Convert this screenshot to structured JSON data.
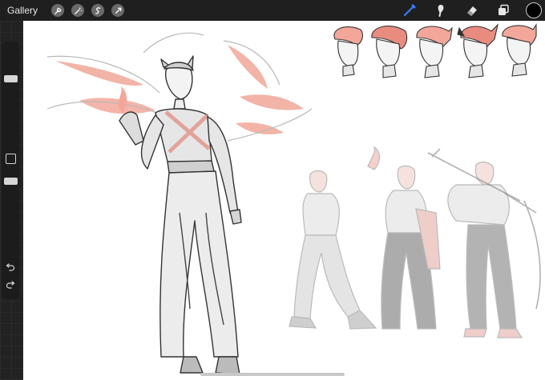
{
  "app": {
    "gallery_label": "Gallery"
  },
  "toolbar_left": [
    "wrench-icon",
    "magic-wand-icon",
    "selection-icon",
    "transform-icon"
  ],
  "toolbar_right": [
    "brush-icon",
    "smudge-icon",
    "eraser-icon",
    "layers-icon"
  ],
  "colors": {
    "toolbar_bg": "#1f1f1f",
    "active_tool": "#3a7bff",
    "current_color": "#000000",
    "accent_sketch": "#f2a79a"
  }
}
